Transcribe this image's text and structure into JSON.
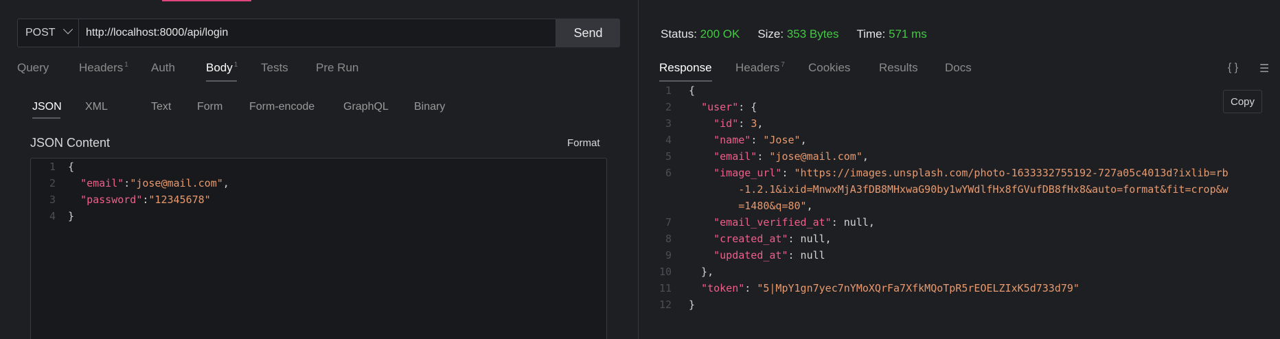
{
  "request": {
    "method": "POST",
    "url": "http://localhost:8000/api/login",
    "send_label": "Send",
    "tabs": [
      {
        "label": "Query",
        "badge": ""
      },
      {
        "label": "Headers",
        "badge": "1"
      },
      {
        "label": "Auth",
        "badge": ""
      },
      {
        "label": "Body",
        "badge": "1"
      },
      {
        "label": "Tests",
        "badge": ""
      },
      {
        "label": "Pre Run",
        "badge": ""
      }
    ],
    "body_tabs": [
      "JSON",
      "XML",
      "Text",
      "Form",
      "Form-encode",
      "GraphQL",
      "Binary"
    ],
    "json_title": "JSON Content",
    "format_label": "Format",
    "body_lines": [
      {
        "n": "1",
        "segs": [
          {
            "t": "{",
            "c": "p"
          }
        ]
      },
      {
        "n": "2",
        "segs": [
          {
            "t": "  ",
            "c": "p"
          },
          {
            "t": "\"email\"",
            "c": "k"
          },
          {
            "t": ":",
            "c": "p"
          },
          {
            "t": "\"jose@mail.com\"",
            "c": "s"
          },
          {
            "t": ",",
            "c": "p"
          }
        ]
      },
      {
        "n": "3",
        "segs": [
          {
            "t": "  ",
            "c": "p"
          },
          {
            "t": "\"password\"",
            "c": "k"
          },
          {
            "t": ":",
            "c": "p"
          },
          {
            "t": "\"12345678\"",
            "c": "s"
          }
        ]
      },
      {
        "n": "4",
        "segs": [
          {
            "t": "}",
            "c": "p"
          }
        ]
      }
    ]
  },
  "response": {
    "status_label": "Status:",
    "status_value": "200 OK",
    "size_label": "Size:",
    "size_value": "353 Bytes",
    "time_label": "Time:",
    "time_value": "571 ms",
    "tabs": [
      {
        "label": "Response",
        "badge": ""
      },
      {
        "label": "Headers",
        "badge": "7"
      },
      {
        "label": "Cookies",
        "badge": ""
      },
      {
        "label": "Results",
        "badge": ""
      },
      {
        "label": "Docs",
        "badge": ""
      }
    ],
    "braces_icon": "{ }",
    "menu_icon": "☰",
    "copy_label": "Copy",
    "lines": [
      {
        "n": "1",
        "segs": [
          {
            "t": "{",
            "c": "p"
          }
        ]
      },
      {
        "n": "2",
        "segs": [
          {
            "t": "  ",
            "c": "p"
          },
          {
            "t": "\"user\"",
            "c": "k"
          },
          {
            "t": ": {",
            "c": "p"
          }
        ]
      },
      {
        "n": "3",
        "segs": [
          {
            "t": "    ",
            "c": "p"
          },
          {
            "t": "\"id\"",
            "c": "k"
          },
          {
            "t": ": ",
            "c": "p"
          },
          {
            "t": "3",
            "c": "n"
          },
          {
            "t": ",",
            "c": "p"
          }
        ]
      },
      {
        "n": "4",
        "segs": [
          {
            "t": "    ",
            "c": "p"
          },
          {
            "t": "\"name\"",
            "c": "k"
          },
          {
            "t": ": ",
            "c": "p"
          },
          {
            "t": "\"Jose\"",
            "c": "s"
          },
          {
            "t": ",",
            "c": "p"
          }
        ]
      },
      {
        "n": "5",
        "segs": [
          {
            "t": "    ",
            "c": "p"
          },
          {
            "t": "\"email\"",
            "c": "k"
          },
          {
            "t": ": ",
            "c": "p"
          },
          {
            "t": "\"jose@mail.com\"",
            "c": "s"
          },
          {
            "t": ",",
            "c": "p"
          }
        ]
      },
      {
        "n": "6",
        "segs": [
          {
            "t": "    ",
            "c": "p"
          },
          {
            "t": "\"image_url\"",
            "c": "k"
          },
          {
            "t": ": ",
            "c": "p"
          },
          {
            "t": "\"https://images.unsplash.com/photo-1633332755192-727a05c4013d?ixlib=rb",
            "c": "s"
          }
        ]
      },
      {
        "n": "",
        "segs": [
          {
            "t": "        ",
            "c": "p"
          },
          {
            "t": "-1.2.1&ixid=MnwxMjA3fDB8MHxwaG90by1wYWdlfHx8fGVufDB8fHx8&auto=format&fit=crop&w",
            "c": "s"
          }
        ]
      },
      {
        "n": "",
        "segs": [
          {
            "t": "        ",
            "c": "p"
          },
          {
            "t": "=1480&q=80\"",
            "c": "s"
          },
          {
            "t": ",",
            "c": "p"
          }
        ]
      },
      {
        "n": "7",
        "segs": [
          {
            "t": "    ",
            "c": "p"
          },
          {
            "t": "\"email_verified_at\"",
            "c": "k"
          },
          {
            "t": ": null,",
            "c": "p"
          }
        ]
      },
      {
        "n": "8",
        "segs": [
          {
            "t": "    ",
            "c": "p"
          },
          {
            "t": "\"created_at\"",
            "c": "k"
          },
          {
            "t": ": null,",
            "c": "p"
          }
        ]
      },
      {
        "n": "9",
        "segs": [
          {
            "t": "    ",
            "c": "p"
          },
          {
            "t": "\"updated_at\"",
            "c": "k"
          },
          {
            "t": ": null",
            "c": "p"
          }
        ]
      },
      {
        "n": "10",
        "segs": [
          {
            "t": "  },",
            "c": "p"
          }
        ]
      },
      {
        "n": "11",
        "segs": [
          {
            "t": "  ",
            "c": "p"
          },
          {
            "t": "\"token\"",
            "c": "k"
          },
          {
            "t": ": ",
            "c": "p"
          },
          {
            "t": "\"5|MpY1gn7yec7nYMoXQrFa7XfkMQoTpR5rEOELZIxK5d733d79\"",
            "c": "s"
          }
        ]
      },
      {
        "n": "12",
        "segs": [
          {
            "t": "}",
            "c": "p"
          }
        ]
      }
    ]
  },
  "colors": {
    "accent": "#e0457b",
    "status_ok": "#43c943",
    "json_key": "#ef5f8a",
    "json_string": "#e89a6e"
  }
}
